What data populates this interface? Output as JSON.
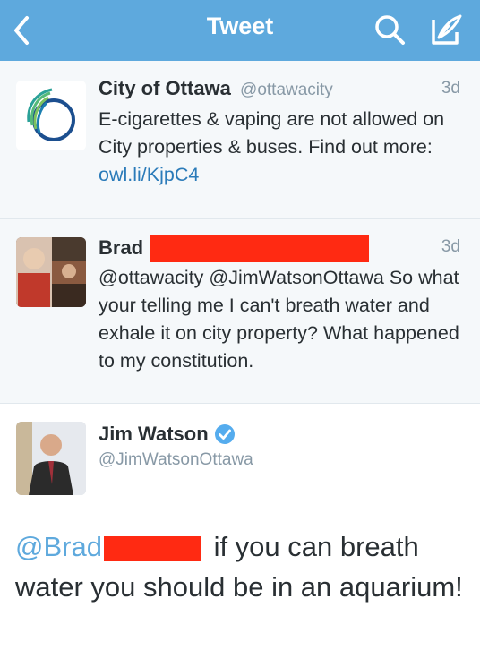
{
  "nav": {
    "title": "Tweet",
    "back_icon": "chevron-left-icon",
    "search_icon": "search-icon",
    "compose_icon": "compose-icon",
    "bg_color": "#5ea9dd"
  },
  "tweets": [
    {
      "name": "City of Ottawa",
      "handle": "@ottawacity",
      "time": "3d",
      "text": "E-cigarettes & vaping are not allowed on City properties & buses. Find out more: ",
      "link": "owl.li/KjpC4"
    },
    {
      "name": "Brad",
      "time": "3d",
      "text": "@ottawacity @JimWatsonOttawa So what your telling me I can't breath water and exhale it on city property? What happened to my constitution."
    }
  ],
  "main_tweet": {
    "name": "Jim Watson",
    "handle": "@JimWatsonOttawa",
    "verified_icon": "verified-badge-icon",
    "mention": "@Brad",
    "text": " if you can breath water you should be in an aquarium!"
  },
  "colors": {
    "link": "#2b7bb9",
    "redaction": "#ff2a12"
  }
}
